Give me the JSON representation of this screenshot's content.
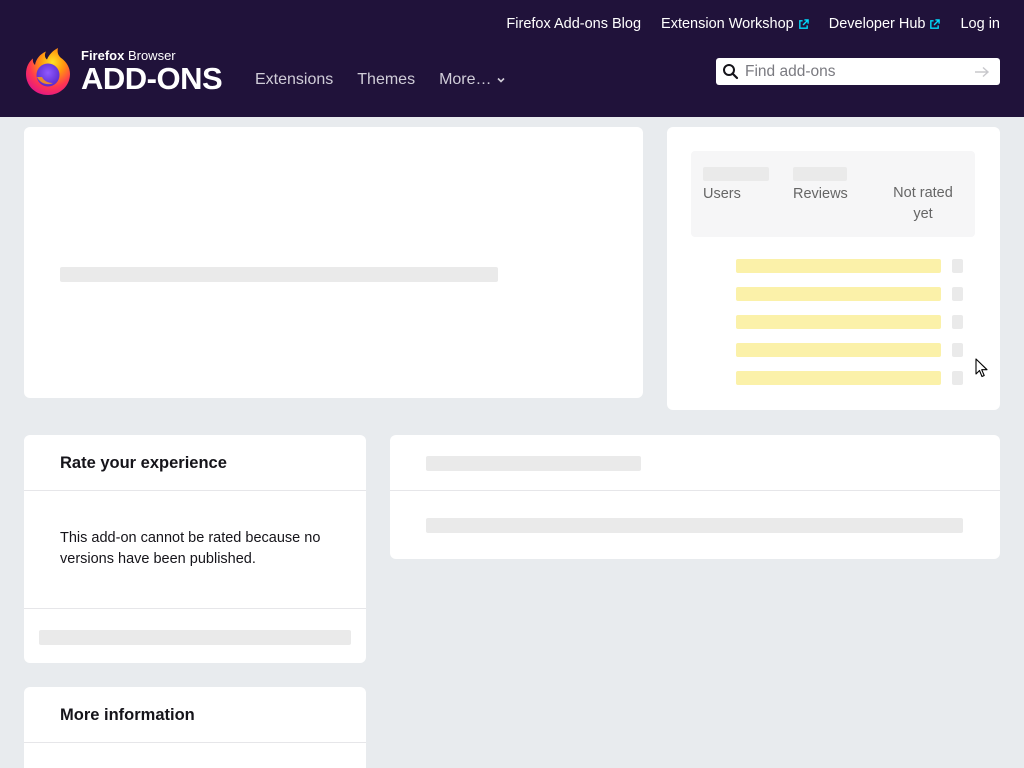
{
  "header": {
    "top_links": [
      {
        "label": "Firefox Add-ons Blog",
        "external": false
      },
      {
        "label": "Extension Workshop",
        "external": true
      },
      {
        "label": "Developer Hub",
        "external": true
      },
      {
        "label": "Log in",
        "external": false
      }
    ],
    "logo": {
      "small_bold": "Firefox",
      "small_rest": " Browser",
      "big": "ADD-ONS"
    },
    "nav": {
      "extensions": "Extensions",
      "themes": "Themes",
      "more": "More…"
    },
    "search": {
      "placeholder": "Find add-ons"
    }
  },
  "stats": {
    "users_label": "Users",
    "reviews_label": "Reviews",
    "rating_label": "Not rated yet"
  },
  "rate": {
    "title": "Rate your experience",
    "message": "This add-on cannot be rated because no versions have been published."
  },
  "more_info": {
    "title": "More information"
  },
  "colors": {
    "header_bg": "#20123a",
    "page_bg": "#e8ebee",
    "rating_bar": "#fbf1a9",
    "link_icon": "#00ddff"
  }
}
